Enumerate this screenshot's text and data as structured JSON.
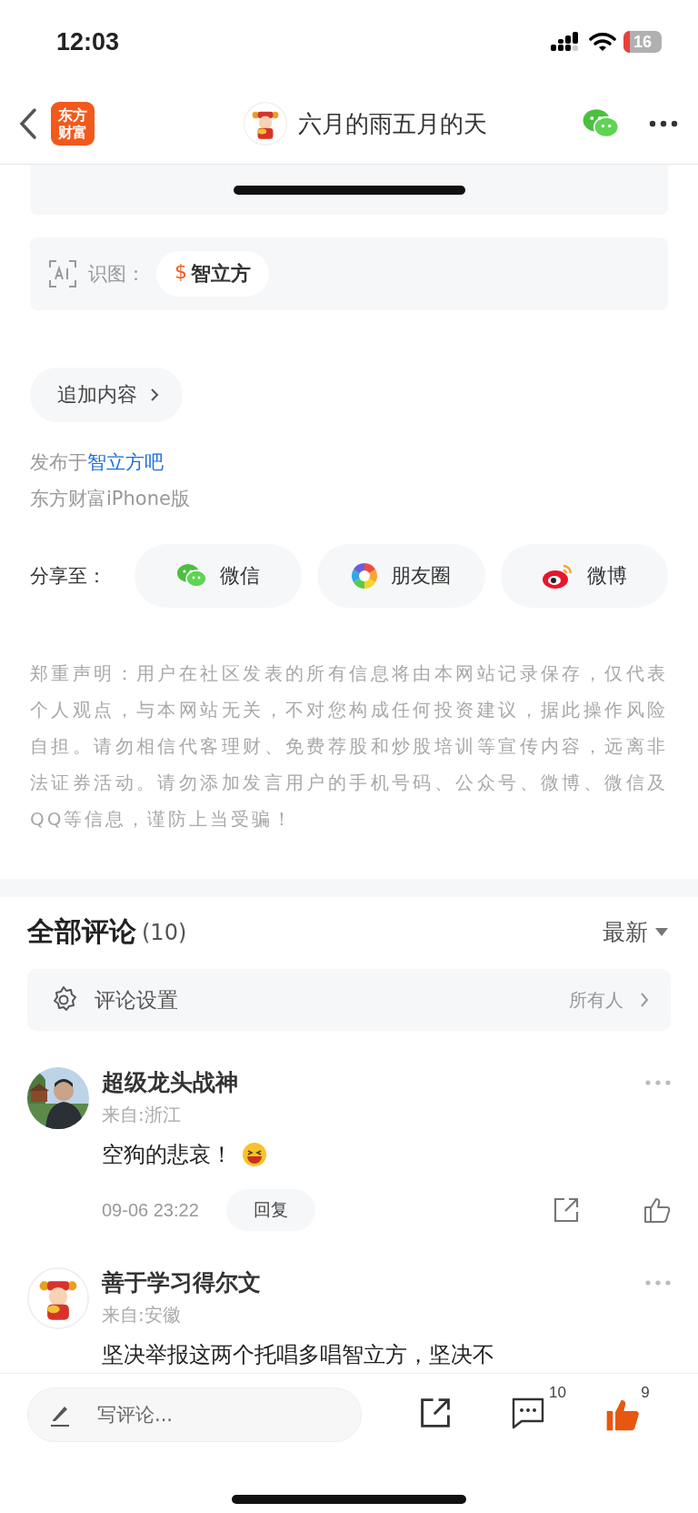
{
  "status_bar": {
    "time": "12:03",
    "battery": "16"
  },
  "nav": {
    "logo": [
      "东方",
      "财富"
    ],
    "title": "六月的雨五月的天"
  },
  "ai_tags": {
    "label": "识图：",
    "chips": [
      {
        "symbol": "$",
        "name": "智立方"
      }
    ]
  },
  "append_button": "追加内容",
  "published": {
    "prefix": "发布于",
    "link": "智立方吧"
  },
  "source": "东方财富iPhone版",
  "share": {
    "label": "分享至：",
    "targets": [
      {
        "kind": "wechat",
        "label": "微信"
      },
      {
        "kind": "moments",
        "label": "朋友圈"
      },
      {
        "kind": "weibo",
        "label": "微博"
      }
    ]
  },
  "disclaimer": "郑重声明：用户在社区发表的所有信息将由本网站记录保存，仅代表个人观点，与本网站无关，不对您构成任何投资建议，据此操作风险自担。请勿相信代客理财、免费荐股和炒股培训等宣传内容，远离非法证券活动。请勿添加发言用户的手机号码、公众号、微博、微信及QQ等信息，谨防上当受骗！",
  "comments_section": {
    "title": "全部评论",
    "count": "(10)",
    "sort": "最新",
    "settings": {
      "label": "评论设置",
      "value": "所有人"
    },
    "comments": [
      {
        "name": "超级龙头战神",
        "location": "来自:浙江",
        "text": "空狗的悲哀！",
        "time": "09-06 23:22",
        "reply": "回复"
      },
      {
        "kind": "mascot",
        "name": "善于学习得尔文",
        "location": "来自:安徽",
        "text": "坚决举报这两个托唱多唱智立方，坚决不"
      }
    ]
  },
  "bottom_bar": {
    "placeholder": "写评论...",
    "comment_count": "10",
    "like_count": "9",
    "liked": true
  }
}
